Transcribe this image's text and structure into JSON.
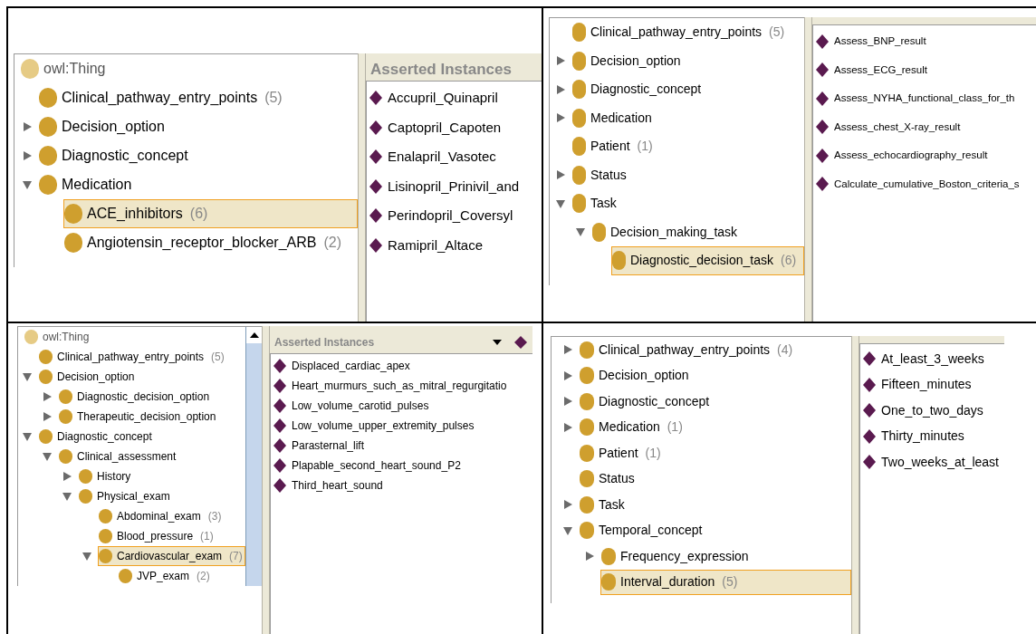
{
  "panels": [
    {
      "tree": [
        {
          "label": "owl:Thing",
          "kind": "root",
          "selected": false
        },
        {
          "label": "Clinical_pathway_entry_points",
          "count": "(5)",
          "kind": "class",
          "selected": false
        },
        {
          "label": "Decision_option",
          "kind": "class",
          "expanded": false,
          "selected": false
        },
        {
          "label": "Diagnostic_concept",
          "kind": "class",
          "expanded": false,
          "selected": false
        },
        {
          "label": "Medication",
          "kind": "class",
          "expanded": true,
          "selected": false,
          "children": [
            {
              "label": "ACE_inhibitors",
              "count": "(6)",
              "kind": "class",
              "selected": true
            },
            {
              "label": "Angiotensin_receptor_blocker_ARB",
              "count": "(2)",
              "kind": "class",
              "selected": false
            }
          ]
        }
      ],
      "instances": {
        "header": "Asserted Instances",
        "items": [
          "Accupril_Quinapril",
          "Captopril_Capoten",
          "Enalapril_Vasotec",
          "Lisinopril_Prinivil_and",
          "Perindopril_Coversyl",
          "Ramipril_Altace"
        ]
      }
    },
    {
      "tree": [
        {
          "label": "Clinical_pathway_entry_points",
          "count": "(5)",
          "kind": "class",
          "selected": false
        },
        {
          "label": "Decision_option",
          "kind": "class",
          "expanded": false,
          "selected": false
        },
        {
          "label": "Diagnostic_concept",
          "kind": "class",
          "expanded": false,
          "selected": false
        },
        {
          "label": "Medication",
          "kind": "class",
          "expanded": false,
          "selected": false
        },
        {
          "label": "Patient",
          "count": "(1)",
          "kind": "class",
          "selected": false
        },
        {
          "label": "Status",
          "kind": "class",
          "expanded": false,
          "selected": false
        },
        {
          "label": "Task",
          "kind": "class",
          "expanded": true,
          "selected": false,
          "children": [
            {
              "label": "Decision_making_task",
              "kind": "class",
              "expanded": true,
              "selected": false,
              "children": [
                {
                  "label": "Diagnostic_decision_task",
                  "count": "(6)",
                  "kind": "class",
                  "selected": true
                }
              ]
            }
          ]
        }
      ],
      "instances": {
        "items": [
          "Assess_BNP_result",
          "Assess_ECG_result",
          "Assess_NYHA_functional_class_for_th",
          "Assess_chest_X-ray_result",
          "Assess_echocardiography_result",
          "Calculate_cumulative_Boston_criteria_s"
        ]
      }
    },
    {
      "tree": [
        {
          "label": "owl:Thing",
          "kind": "root",
          "selected": false
        },
        {
          "label": "Clinical_pathway_entry_points",
          "count": "(5)",
          "kind": "class",
          "selected": false
        },
        {
          "label": "Decision_option",
          "kind": "class",
          "expanded": true,
          "selected": false,
          "children": [
            {
              "label": "Diagnostic_decision_option",
              "kind": "class",
              "expanded": false,
              "selected": false
            },
            {
              "label": "Therapeutic_decision_option",
              "kind": "class",
              "expanded": false,
              "selected": false
            }
          ]
        },
        {
          "label": "Diagnostic_concept",
          "kind": "class",
          "expanded": true,
          "selected": false,
          "children": [
            {
              "label": "Clinical_assessment",
              "kind": "class",
              "expanded": true,
              "selected": false,
              "children": [
                {
                  "label": "History",
                  "kind": "class",
                  "expanded": false,
                  "selected": false
                },
                {
                  "label": "Physical_exam",
                  "kind": "class",
                  "expanded": true,
                  "selected": false,
                  "children": [
                    {
                      "label": "Abdominal_exam",
                      "count": "(3)",
                      "kind": "class",
                      "selected": false
                    },
                    {
                      "label": "Blood_pressure",
                      "count": "(1)",
                      "kind": "class",
                      "selected": false
                    },
                    {
                      "label": "Cardiovascular_exam",
                      "count": "(7)",
                      "kind": "class",
                      "expanded": true,
                      "selected": true,
                      "children": [
                        {
                          "label": "JVP_exam",
                          "count": "(2)",
                          "kind": "class",
                          "selected": false
                        }
                      ]
                    }
                  ]
                }
              ]
            }
          ]
        }
      ],
      "instances": {
        "header": "Asserted Instances",
        "toolbar": true,
        "items": [
          "Displaced_cardiac_apex",
          "Heart_murmurs_such_as_mitral_regurgitatio",
          "Low_volume_carotid_pulses",
          "Low_volume_upper_extremity_pulses",
          "Parasternal_lift",
          "Plapable_second_heart_sound_P2",
          "Third_heart_sound"
        ]
      }
    },
    {
      "tree": [
        {
          "label": "Clinical_pathway_entry_points",
          "count": "(4)",
          "kind": "class",
          "expanded": false,
          "selected": false
        },
        {
          "label": "Decision_option",
          "kind": "class",
          "expanded": false,
          "selected": false
        },
        {
          "label": "Diagnostic_concept",
          "kind": "class",
          "expanded": false,
          "selected": false
        },
        {
          "label": "Medication",
          "count": "(1)",
          "kind": "class",
          "expanded": false,
          "selected": false
        },
        {
          "label": "Patient",
          "count": "(1)",
          "kind": "class",
          "selected": false
        },
        {
          "label": "Status",
          "kind": "class",
          "selected": false
        },
        {
          "label": "Task",
          "kind": "class",
          "expanded": false,
          "selected": false
        },
        {
          "label": "Temporal_concept",
          "kind": "class",
          "expanded": true,
          "selected": false,
          "children": [
            {
              "label": "Frequency_expression",
              "kind": "class",
              "expanded": false,
              "selected": false
            },
            {
              "label": "Interval_duration",
              "count": "(5)",
              "kind": "class",
              "selected": true
            }
          ]
        }
      ],
      "instances": {
        "items": [
          "At_least_3_weeks",
          "Fifteen_minutes",
          "One_to_two_days",
          "Thirty_minutes",
          "Two_weeks_at_least"
        ]
      }
    }
  ]
}
